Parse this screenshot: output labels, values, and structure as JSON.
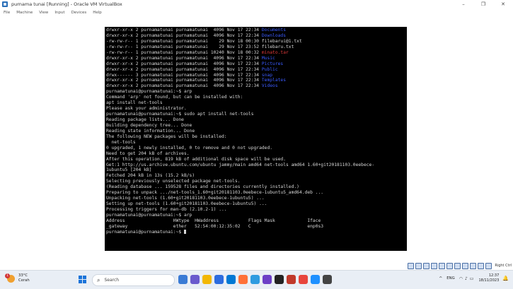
{
  "window": {
    "title": "purnama tunai [Running] - Oracle VM VirtualBox",
    "controls": {
      "minimize": "–",
      "maximize": "❐",
      "close": "✕"
    },
    "icon": "virtualbox-icon"
  },
  "menu": [
    "File",
    "Machine",
    "View",
    "Input",
    "Devices",
    "Help"
  ],
  "terminal": {
    "lines": [
      [
        {
          "t": "drwxr-xr-x 2 purnamatunai purnamatunai  4096 Nov 17 22:34 "
        },
        {
          "t": "Documents",
          "c": "blue"
        }
      ],
      [
        {
          "t": "drwxr-xr-x 2 purnamatunai purnamatunai  4096 Nov 17 22:34 "
        },
        {
          "t": "Downloads",
          "c": "blue"
        }
      ],
      [
        {
          "t": "-rw-rw-r-- 1 purnamatunai purnamatunai    29 Nov 18 00:30 filebarui@1.txt"
        }
      ],
      [
        {
          "t": "-rw-rw-r-- 1 purnamatunai purnamatunai    29 Nov 17 23:52 filebaru.txt"
        }
      ],
      [
        {
          "t": "-rw-rw-r-- 1 purnamatunai purnamatunai 10240 Nov 18 00:32 "
        },
        {
          "t": "minato.tar",
          "c": "red"
        }
      ],
      [
        {
          "t": "drwxr-xr-x 2 purnamatunai purnamatunai  4096 Nov 17 22:34 "
        },
        {
          "t": "Music",
          "c": "blue"
        }
      ],
      [
        {
          "t": "drwxr-xr-x 2 purnamatunai purnamatunai  4096 Nov 17 22:34 "
        },
        {
          "t": "Pictures",
          "c": "blue"
        }
      ],
      [
        {
          "t": "drwxr-xr-x 2 purnamatunai purnamatunai  4096 Nov 17 22:34 "
        },
        {
          "t": "Public",
          "c": "blue"
        }
      ],
      [
        {
          "t": "drwx------ 3 purnamatunai purnamatunai  4096 Nov 17 22:34 "
        },
        {
          "t": "snap",
          "c": "blue"
        }
      ],
      [
        {
          "t": "drwxr-xr-x 2 purnamatunai purnamatunai  4096 Nov 17 22:34 "
        },
        {
          "t": "Templates",
          "c": "blue"
        }
      ],
      [
        {
          "t": "drwxr-xr-x 2 purnamatunai purnamatunai  4096 Nov 17 22:34 "
        },
        {
          "t": "Videos",
          "c": "blue"
        }
      ],
      [
        {
          "t": "purnamatunai@purnamatunai:~$ arp"
        }
      ],
      [
        {
          "t": "Command 'arp' not found, but can be installed with:"
        }
      ],
      [
        {
          "t": "apt install net-tools"
        }
      ],
      [
        {
          "t": "Please ask your administrator."
        }
      ],
      [
        {
          "t": "purnamatunai@purnamatunai:~$ sudo apt install net-tools"
        }
      ],
      [
        {
          "t": "Reading package lists... Done"
        }
      ],
      [
        {
          "t": "Building dependency tree... Done"
        }
      ],
      [
        {
          "t": "Reading state information... Done"
        }
      ],
      [
        {
          "t": "The following NEW packages will be installed:"
        }
      ],
      [
        {
          "t": "  net-tools"
        }
      ],
      [
        {
          "t": "0 upgraded, 1 newly installed, 0 to remove and 0 not upgraded."
        }
      ],
      [
        {
          "t": "Need to get 204 kB of archives."
        }
      ],
      [
        {
          "t": "After this operation, 819 kB of additional disk space will be used."
        }
      ],
      [
        {
          "t": "Get:1 http://us.archive.ubuntu.com/ubuntu jammy/main amd64 net-tools amd64 1.60+git20181103.0eebece-"
        }
      ],
      [
        {
          "t": "1ubuntu5 [204 kB]"
        }
      ],
      [
        {
          "t": "Fetched 204 kB in 13s (15.2 kB/s)"
        }
      ],
      [
        {
          "t": "Selecting previously unselected package net-tools."
        }
      ],
      [
        {
          "t": "(Reading database ... 159528 files and directories currently installed.)"
        }
      ],
      [
        {
          "t": "Preparing to unpack .../net-tools_1.60+git20181103.0eebece-1ubuntu5_amd64.deb ..."
        }
      ],
      [
        {
          "t": "Unpacking net-tools (1.60+git20181103.0eebece-1ubuntu5) ..."
        }
      ],
      [
        {
          "t": "Setting up net-tools (1.60+git20181103.0eebece-1ubuntu5) ..."
        }
      ],
      [
        {
          "t": "Processing triggers for man-db (2.10.2-1) ..."
        }
      ],
      [
        {
          "t": "purnamatunai@purnamatunai:~$ arp"
        }
      ],
      [
        {
          "t": "Address                  HWtype  HWaddress           Flags Mask            Iface"
        }
      ],
      [
        {
          "t": "_gateway                 ether   52:54:00:12:35:02   C                     enp0s3"
        }
      ],
      [
        {
          "t": "purnamatunai@purnamatunai:~$ "
        }
      ]
    ]
  },
  "statusbar": {
    "host_key": "Right Ctrl"
  },
  "taskbar": {
    "weather": {
      "badge": "1",
      "temp": "33°C",
      "condition": "Cerah"
    },
    "search_placeholder": "Search",
    "search_icon": "search-icon",
    "lang": "ENG",
    "time": "12:37",
    "date": "18/11/2023",
    "app_colors": [
      "#3a7bd5",
      "#6a5acd",
      "#f2b705",
      "#2d6cdf",
      "#0078d4",
      "#ff7139",
      "#2f9be0",
      "#6d3fc6",
      "#222222",
      "#c0392b",
      "#e8453c",
      "#1e90ff",
      "#444444"
    ]
  }
}
